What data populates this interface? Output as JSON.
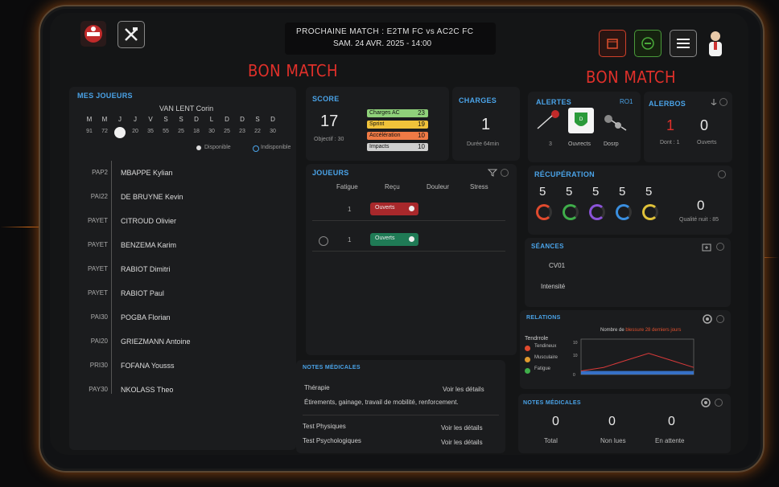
{
  "header": {
    "match_line1": "PROCHAINE MATCH  :  E2TM FC  vs  AC2C FC",
    "match_line2": "SAM. 24 AVR. 2025 - 14:00",
    "bon_match_left": "BON MATCH",
    "bon_match_right": "BON MATCH"
  },
  "players": {
    "title": "MES JOUEURS",
    "selected_name": "VAN LENT Corin",
    "day_letters": [
      "M",
      "M",
      "J",
      "J",
      "V",
      "S",
      "S",
      "D",
      "L",
      "D",
      "D",
      "S",
      "D"
    ],
    "day_numbers": [
      "91",
      "72",
      "",
      "20",
      "35",
      "55",
      "25",
      "18",
      "30",
      "25",
      "23",
      "22",
      "30"
    ],
    "legend_available": "Disponible",
    "legend_unavailable": "Indisponible",
    "list": [
      {
        "status": "PAP2",
        "name": "MBAPPE Kylian"
      },
      {
        "status": "PAI22",
        "name": "DE BRUYNE Kevin"
      },
      {
        "status": "PAYET",
        "name": "CITROUD Olivier"
      },
      {
        "status": "PAYET",
        "name": "BENZEMA Karim"
      },
      {
        "status": "PAYET",
        "name": "RABIOT Dimitri"
      },
      {
        "status": "PAYET",
        "name": "RABIOT Paul"
      },
      {
        "status": "PAI30",
        "name": "POGBA Florian"
      },
      {
        "status": "PAI20",
        "name": "GRIEZMANN Antoine"
      },
      {
        "status": "PRI30",
        "name": "FOFANA Yousss"
      },
      {
        "status": "PAY30",
        "name": "NKOLASS Theo"
      }
    ]
  },
  "score": {
    "title": "SCORE",
    "value": "17",
    "objective": "Objectif : 30",
    "bars": [
      {
        "label": "Charges AC",
        "value": "23",
        "color": "#8fd17a"
      },
      {
        "label": "Sprint",
        "value": "19",
        "color": "#f0c23a"
      },
      {
        "label": "Accélération",
        "value": "10",
        "color": "#ef7a45"
      },
      {
        "label": "Impacts",
        "value": "10",
        "color": "#cfcfcf"
      }
    ]
  },
  "charges": {
    "title": "CHARGES",
    "value": "1",
    "duration": "Durée 64min"
  },
  "alertes": {
    "title": "ALERTES",
    "count_label": "RO1",
    "label1": "Ouvrects",
    "label2": "Dosrp",
    "sub": "3"
  },
  "alertes2": {
    "title": "ALERBOS",
    "value_left": "1",
    "value_right": "0",
    "sub_left": "Dont : 1",
    "sub_right": "Ouverts"
  },
  "joueurs": {
    "title": "JOUEURS",
    "columns": [
      "Fatigue",
      "Reçu",
      "Douleur",
      "Stress"
    ],
    "rows": [
      {
        "fatigue": "1",
        "status": "Ouverts",
        "color": "#a8282b"
      },
      {
        "fatigue": "1",
        "status": "Ouverts",
        "color": "#1f7a55"
      }
    ]
  },
  "recuperation": {
    "title": "RÉCUPÉRATION",
    "values": [
      "5",
      "5",
      "5",
      "5",
      "5"
    ],
    "ring_colors": [
      "#e04a2e",
      "#3fae4a",
      "#8a53d8",
      "#3a8fe0",
      "#e0c23a"
    ],
    "quality_value": "0",
    "quality_label": "Qualité nuit : 85"
  },
  "seances": {
    "title": "SÉANCES",
    "line1": "CV01",
    "line2": "Intensité"
  },
  "relations": {
    "title": "RELATIONS",
    "chart_title_a": "Nombre de ",
    "chart_title_b": "blessure 28 derniers jours",
    "legend_title": "Tendrrole",
    "legend": [
      {
        "label": "Tendineux",
        "color": "#e04a2e"
      },
      {
        "label": "Musculaire",
        "color": "#e09a2e"
      },
      {
        "label": "Fatigue",
        "color": "#3fae4a"
      }
    ],
    "y_ticks": [
      "10",
      "10",
      "0"
    ]
  },
  "notes_left": {
    "title": "NOTES MÉDICALES",
    "therapy": "Thérapie",
    "therapy_link": "Voir les détails",
    "therapy_desc": "Étirements, gainage, travail de mobilité, renforcement.",
    "test1": "Test Physiques",
    "test1_link": "Voir les détails",
    "test2": "Test Psychologiques",
    "test2_link": "Voir les détails"
  },
  "notes_right": {
    "title": "NOTES MÉDICALES",
    "values": [
      "0",
      "0",
      "0"
    ],
    "labels": [
      "Total",
      "Non lues",
      "En attente"
    ]
  },
  "chart_data": {
    "type": "area",
    "title": "Nombre de blessure 28 derniers jours",
    "x": [
      0,
      1,
      2,
      3,
      4,
      5
    ],
    "series": [
      {
        "values": [
          1,
          1,
          1,
          1,
          1,
          1
        ]
      },
      {
        "values": [
          1,
          2,
          4,
          6,
          4,
          2
        ]
      }
    ],
    "ylim": [
      0,
      10
    ]
  }
}
